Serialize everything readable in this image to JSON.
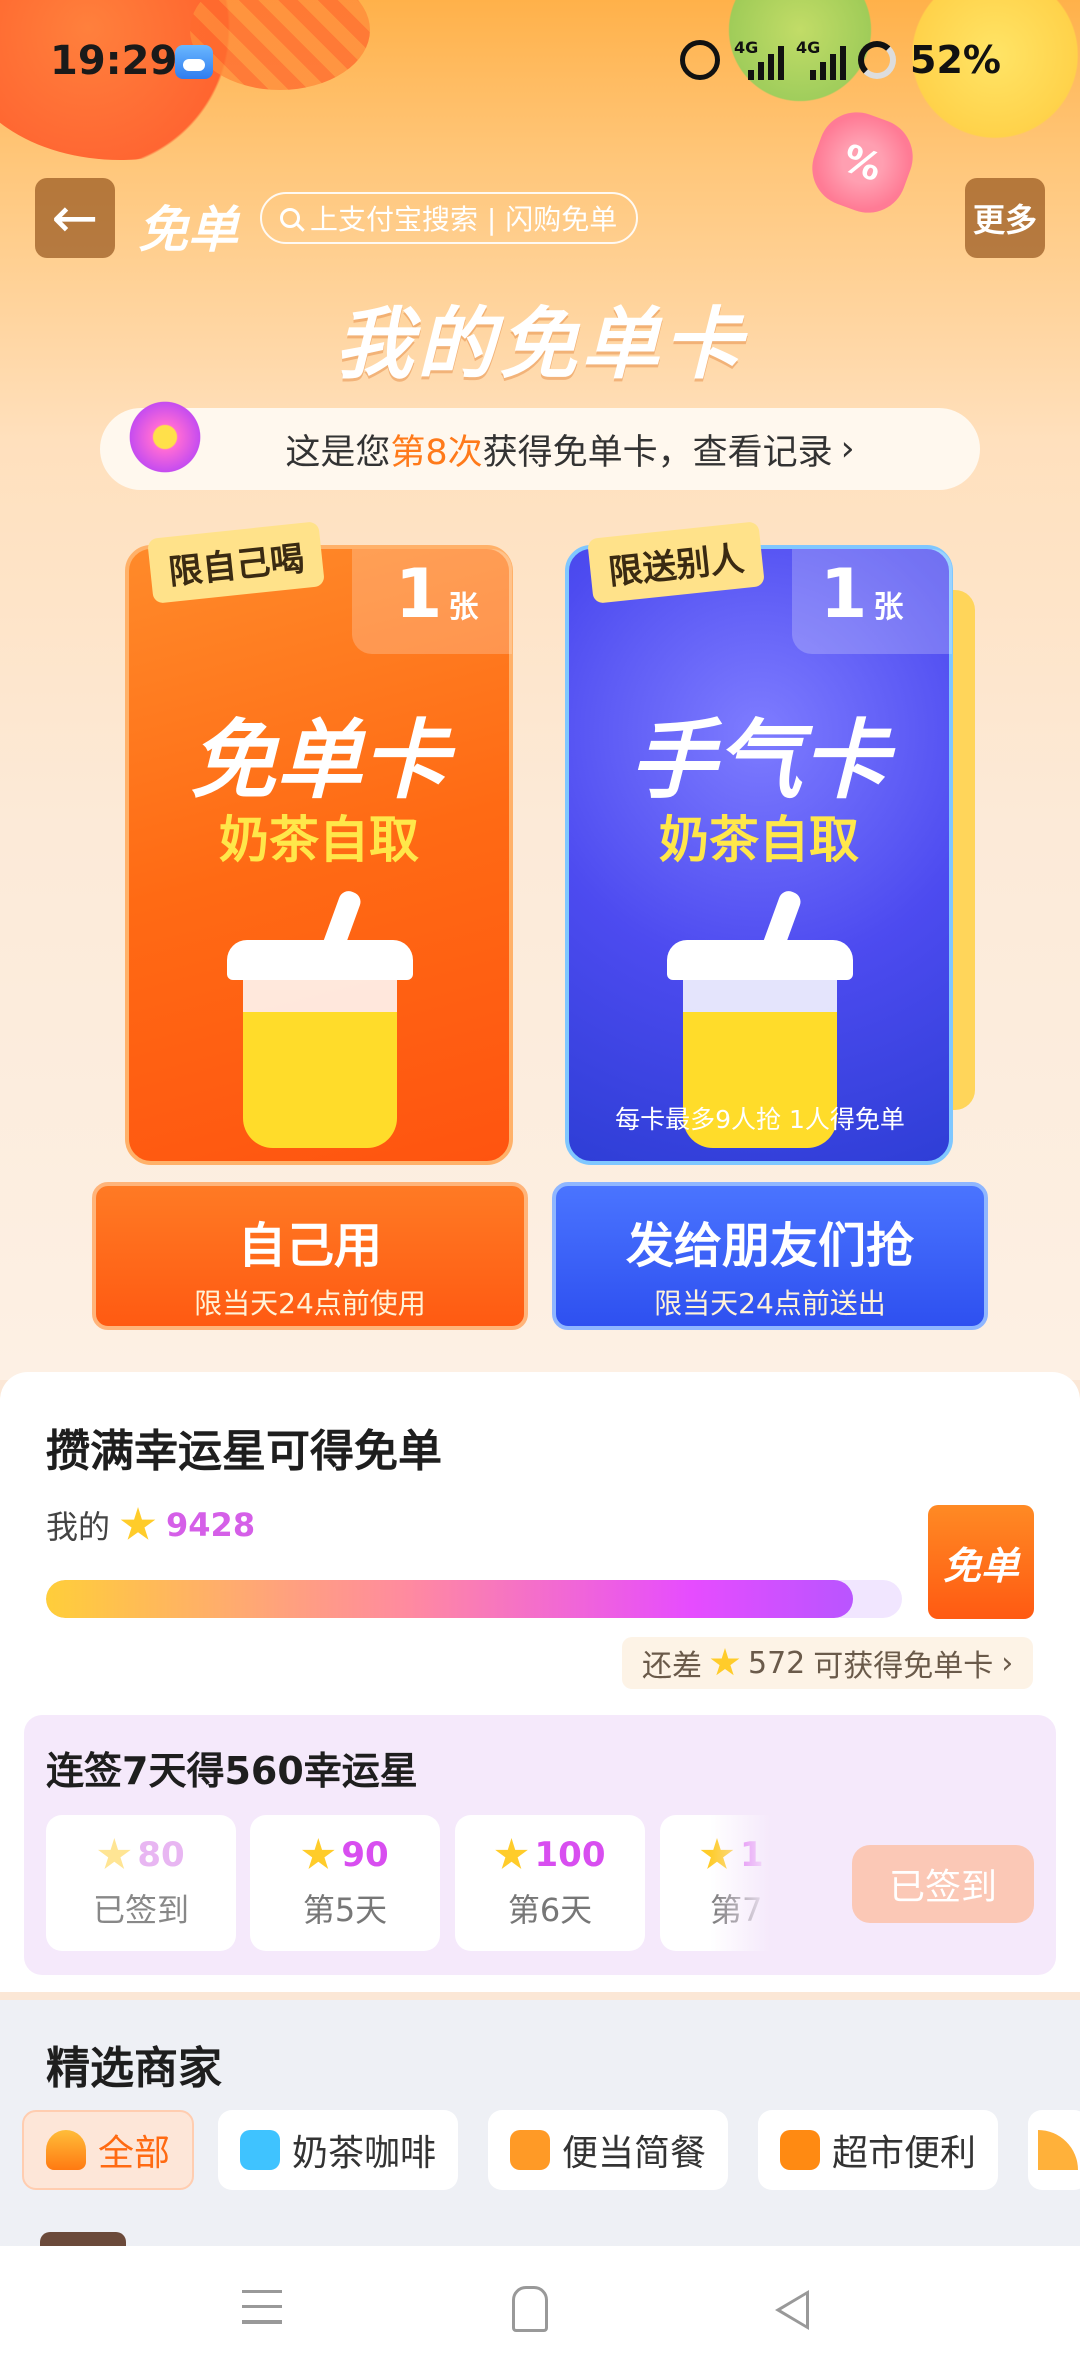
{
  "status_bar": {
    "time": "19:29",
    "network_1": "4G",
    "network_2": "4G",
    "battery": "52%"
  },
  "header": {
    "title": "免单",
    "search_text": "上支付宝搜索 | 闪购免单",
    "more_label": "更多",
    "page_heading": "我的免单卡",
    "decor_badge": "%"
  },
  "record_bar": {
    "prefix": "这是您",
    "highlight": "第8次",
    "suffix": "获得免单卡，查看记录",
    "arrow": "›"
  },
  "cards": [
    {
      "tag": "限自己喝",
      "count": "1",
      "unit": "张",
      "name": "免单卡",
      "subtitle": "奶茶自取",
      "button_label": "自己用",
      "button_sub": "限当天24点前使用"
    },
    {
      "tag": "限送别人",
      "count": "1",
      "unit": "张",
      "name": "手气卡",
      "subtitle": "奶茶自取",
      "note": "每卡最多9人抢 1人得免单",
      "button_label": "发给朋友们抢",
      "button_sub": "限当天24点前送出"
    }
  ],
  "lucky_star": {
    "title": "攒满幸运星可得免单",
    "mine_label": "我的",
    "stars": "9428",
    "progress_fraction": 0.943,
    "badge": "免单",
    "remain_prefix": "还差",
    "remain_num": "572",
    "remain_suffix": "可获得免单卡",
    "remain_arrow": "›"
  },
  "checkin": {
    "title": "连签7天得560幸运星",
    "days": [
      {
        "points": "80",
        "label": "已签到",
        "done": true
      },
      {
        "points": "90",
        "label": "第5天",
        "done": false
      },
      {
        "points": "100",
        "label": "第6天",
        "done": false
      },
      {
        "points": "1",
        "label": "第7",
        "done": false
      }
    ],
    "button_label": "已签到"
  },
  "merchants": {
    "title": "精选商家",
    "chips": [
      {
        "label": "全部",
        "active": true,
        "icon": "bowl-icon"
      },
      {
        "label": "奶茶咖啡",
        "active": false,
        "icon": "drink-icon"
      },
      {
        "label": "便当简餐",
        "active": false,
        "icon": "bento-icon"
      },
      {
        "label": "超市便利",
        "active": false,
        "icon": "store-icon"
      },
      {
        "label": "",
        "active": false,
        "icon": "pizza-icon"
      }
    ]
  },
  "colors": {
    "accent_orange": "#ff6a12",
    "accent_blue": "#2e50f0",
    "star_purple": "#d84ef0"
  }
}
